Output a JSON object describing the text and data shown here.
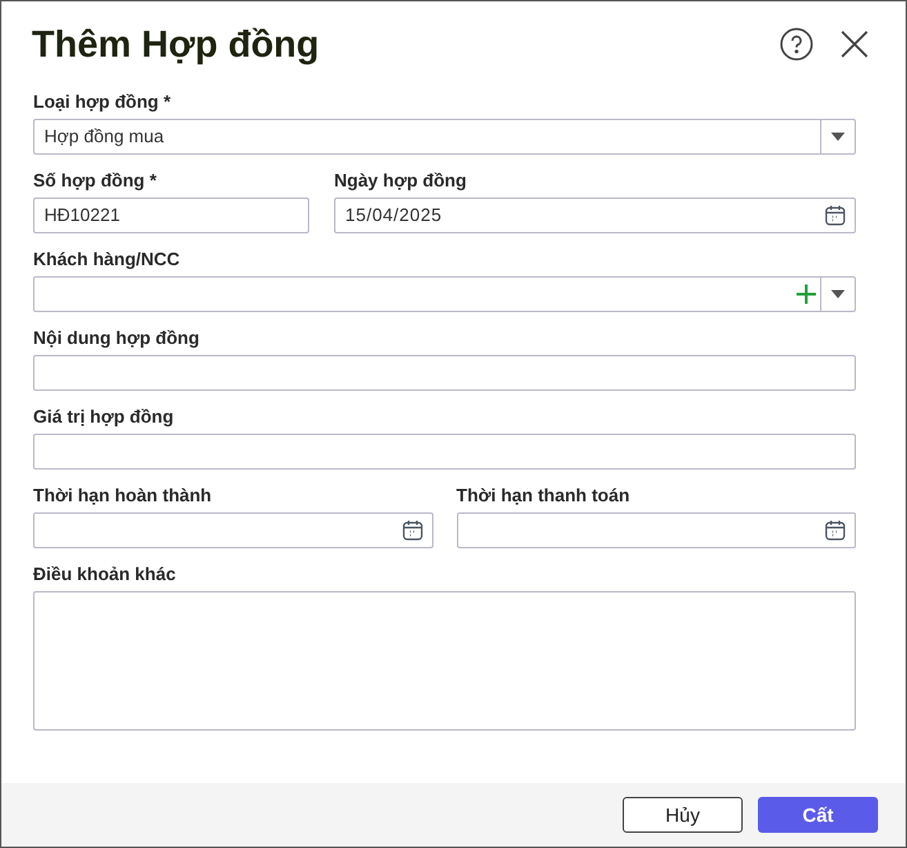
{
  "dialog": {
    "title": "Thêm Hợp đồng"
  },
  "rows": [
    {
      "kind": "single",
      "fields": [
        {
          "label": "Loại hợp đồng *",
          "kind": "select",
          "value": "Hợp đồng mua"
        }
      ]
    },
    {
      "kind": "narrow-wide",
      "fields": [
        {
          "label": "Số hợp đồng *",
          "kind": "text",
          "value": "HĐ10221"
        },
        {
          "label": "Ngày hợp đồng",
          "kind": "date",
          "value": "15/04/2025"
        }
      ]
    },
    {
      "kind": "single",
      "fields": [
        {
          "label": "Khách hàng/NCC",
          "kind": "combo-add"
        }
      ]
    },
    {
      "kind": "single",
      "fields": [
        {
          "label": "Nội dung hợp đồng",
          "kind": "text"
        }
      ]
    },
    {
      "kind": "single",
      "fields": [
        {
          "label": "Giá trị hợp đồng",
          "kind": "text"
        }
      ]
    },
    {
      "kind": "half",
      "fields": [
        {
          "label": "Thời hạn hoàn thành",
          "kind": "date"
        },
        {
          "label": "Thời hạn thanh toán",
          "kind": "date"
        }
      ]
    },
    {
      "kind": "single",
      "fields": [
        {
          "label": "Điều khoản khác",
          "kind": "textarea"
        }
      ]
    }
  ],
  "buttons": [
    {
      "label": "Hủy",
      "kind": "secondary"
    },
    {
      "label": "Cất",
      "kind": "primary"
    }
  ]
}
